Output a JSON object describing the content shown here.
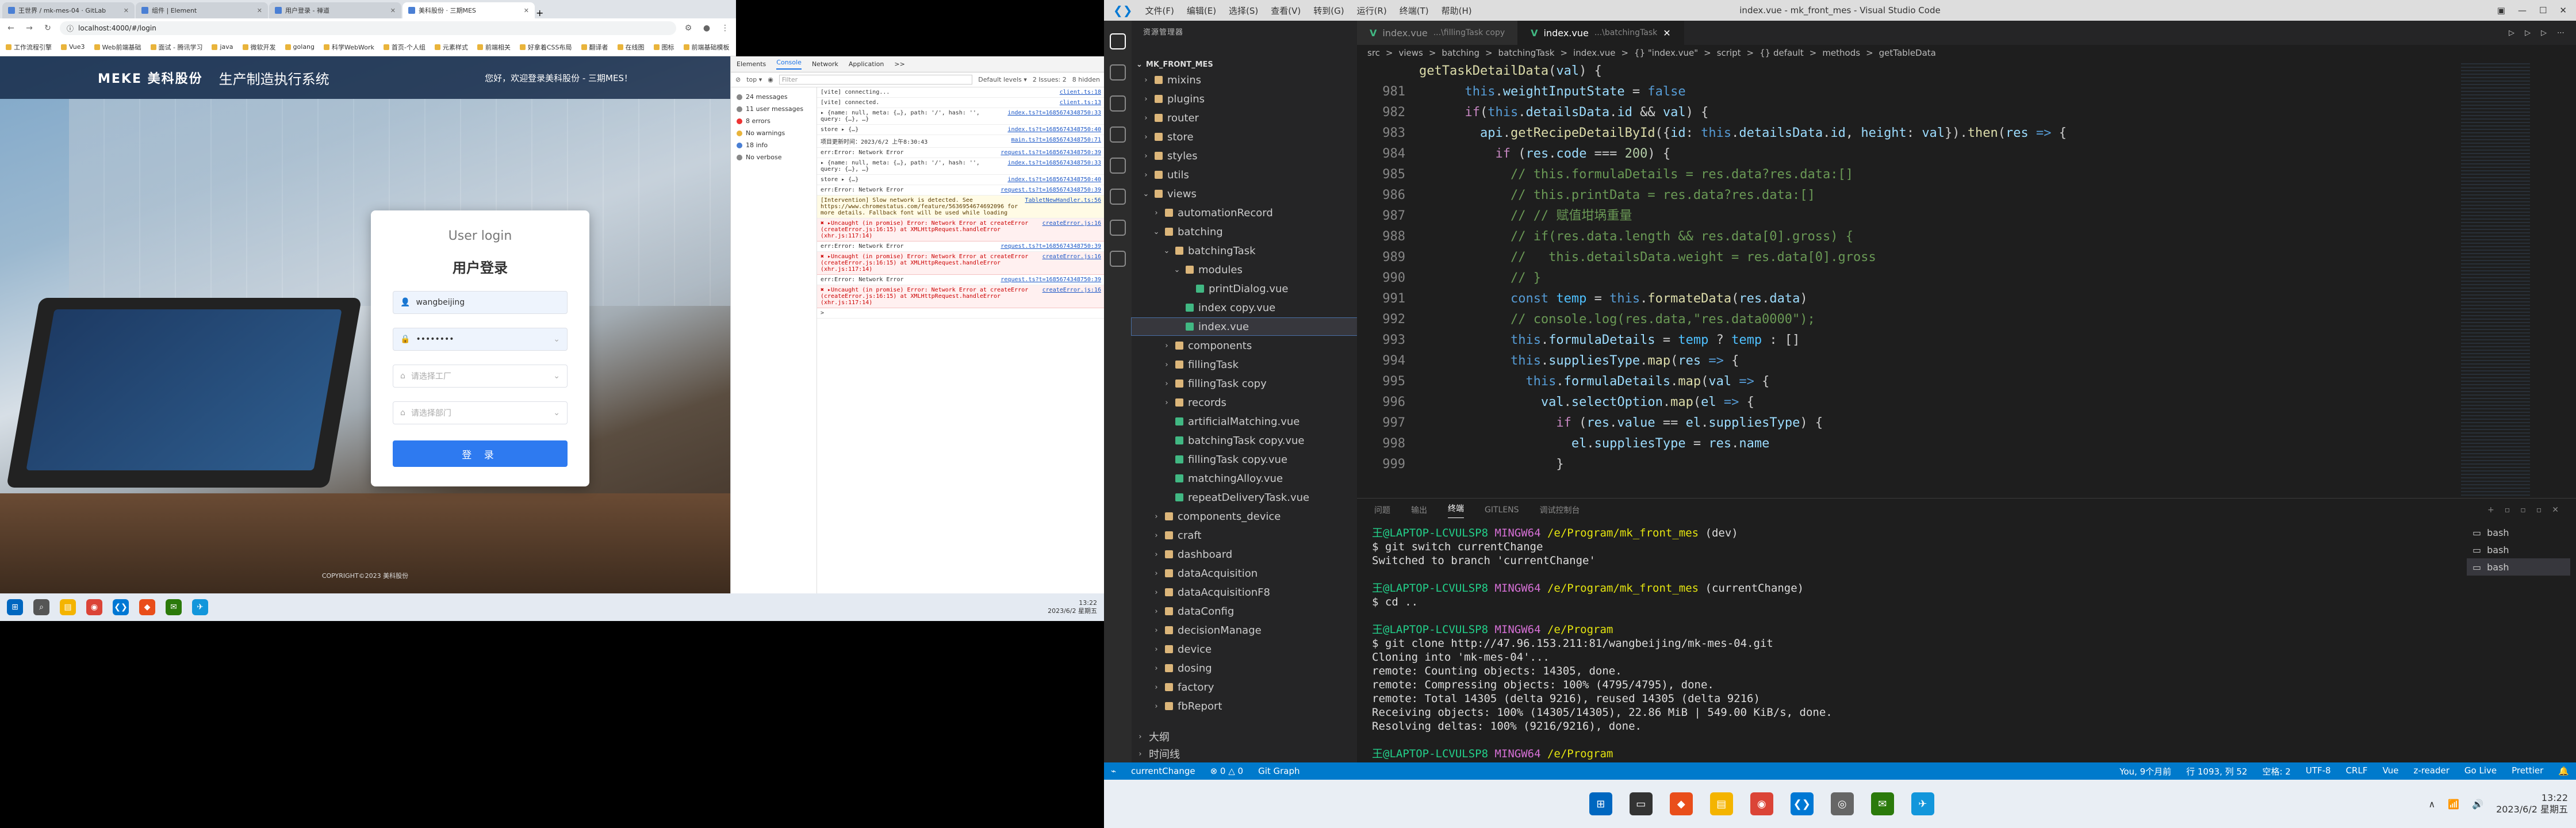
{
  "browser": {
    "tabs": [
      {
        "label": "王世界 / mk-mes-04 · GitLab",
        "active": false
      },
      {
        "label": "组件 | Element",
        "active": false
      },
      {
        "label": "用户登录 - 禅道",
        "active": false
      },
      {
        "label": "美科股份 · 三期MES",
        "active": true
      }
    ],
    "url": "localhost:4000/#/login",
    "bookmarks": [
      "工作流程引擎",
      "Vue3",
      "Web前端基础",
      "面试 - 腾讯学习",
      "java",
      "微软开发",
      "golang",
      "科学WebWork",
      "首页-个人组",
      "元素样式",
      "前端相关",
      "好拿着CSS布局",
      "翻译者",
      "在线图",
      "图标",
      "前端基础模板",
      "更多书签"
    ]
  },
  "page": {
    "logo": "MEKE 美科股份",
    "system_title": "生产制造执行系统",
    "welcome": "您好，欢迎登录美科股份 - 三期MES！",
    "login_en": "User login",
    "login_cn": "用户登录",
    "username": "wangbeijing",
    "password": "••••••••",
    "field3_placeholder": "请选择工厂",
    "field4_placeholder": "请选择部门",
    "login_btn": "登 录",
    "copyright": "COPYRIGHT©2023 美科股份"
  },
  "devtools": {
    "tabs": [
      "Elements",
      "Console",
      "Network",
      "Application",
      ">>"
    ],
    "active_tab": "Console",
    "filter": "Filter",
    "level": "Default levels ▾",
    "issues": "2 Issues: 2",
    "hidden": "8 hidden",
    "side": [
      {
        "label": "24 messages",
        "kind": "all"
      },
      {
        "label": "11 user messages",
        "kind": "all"
      },
      {
        "label": "8 errors",
        "kind": "err"
      },
      {
        "label": "No warnings",
        "kind": "warn"
      },
      {
        "label": "18 info",
        "kind": "info"
      },
      {
        "label": "No verbose",
        "kind": "all"
      }
    ],
    "logs": [
      {
        "t": "[vite] connecting...",
        "s": "client.ts:18",
        "k": ""
      },
      {
        "t": "[vite] connected.",
        "s": "client.ts:13",
        "k": ""
      },
      {
        "t": "▸ {name: null, meta: {…}, path: '/', hash: '', query: {…}, …}",
        "s": "index.ts?t=1685674348750:33",
        "k": ""
      },
      {
        "t": "store ▸ {…}",
        "s": "index.ts?t=1685674348750:40",
        "k": ""
      },
      {
        "t": "项目更新时间：2023/6/2 上午8:30:43",
        "s": "main.ts?t=1685674348750:71",
        "k": ""
      },
      {
        "t": "err:Error: Network Error",
        "s": "request.ts?t=1685674348750:39",
        "k": ""
      },
      {
        "t": "▸ {name: null, meta: {…}, path: '/', hash: '', query: {…}, …}",
        "s": "index.ts?t=1685674348750:33",
        "k": ""
      },
      {
        "t": "store ▸ {…}",
        "s": "index.ts?t=1685674348750:40",
        "k": ""
      },
      {
        "t": "err:Error: Network Error",
        "s": "request.ts?t=1685674348750:39",
        "k": ""
      },
      {
        "t": "[Intervention] Slow network is detected. See https://www.chromestatus.com/feature/5636954674692096 for more details. Fallback font will be used while loading",
        "s": "TabletNewHandler.ts:56",
        "k": "warn"
      },
      {
        "t": "✖ ▸Uncaught (in promise) Error: Network Error at createError (createError.js:16:15) at XMLHttpRequest.handleError (xhr.js:117:14)",
        "s": "createError.js:16",
        "k": "err"
      },
      {
        "t": "err:Error: Network Error",
        "s": "request.ts?t=1685674348750:39",
        "k": ""
      },
      {
        "t": "✖ ▸Uncaught (in promise) Error: Network Error at createError (createError.js:16:15) at XMLHttpRequest.handleError (xhr.js:117:14)",
        "s": "createError.js:16",
        "k": "err"
      },
      {
        "t": "err:Error: Network Error",
        "s": "request.ts?t=1685674348750:39",
        "k": ""
      },
      {
        "t": "✖ ▸Uncaught (in promise) Error: Network Error at createError (createError.js:16:15) at XMLHttpRequest.handleError (xhr.js:117:14)",
        "s": "createError.js:16",
        "k": "err"
      },
      {
        "t": ">",
        "s": "",
        "k": ""
      }
    ]
  },
  "taskbar1": {
    "time": "13:22",
    "date": "2023/6/2 星期五"
  },
  "vscode": {
    "menu": [
      "文件(F)",
      "编辑(E)",
      "选择(S)",
      "查看(V)",
      "转到(G)",
      "运行(R)",
      "终端(T)",
      "帮助(H)"
    ],
    "title": "index.vue - mk_front_mes - Visual Studio Code",
    "explorer_title": "资源管理器",
    "root": "MK_FRONT_MES",
    "tree": [
      {
        "n": "mixins",
        "d": 1,
        "t": "folder"
      },
      {
        "n": "plugins",
        "d": 1,
        "t": "folder"
      },
      {
        "n": "router",
        "d": 1,
        "t": "folder"
      },
      {
        "n": "store",
        "d": 1,
        "t": "folder"
      },
      {
        "n": "styles",
        "d": 1,
        "t": "folder"
      },
      {
        "n": "utils",
        "d": 1,
        "t": "folder"
      },
      {
        "n": "views",
        "d": 1,
        "t": "open"
      },
      {
        "n": "automationRecord",
        "d": 2,
        "t": "folder"
      },
      {
        "n": "batching",
        "d": 2,
        "t": "open"
      },
      {
        "n": "batchingTask",
        "d": 3,
        "t": "open"
      },
      {
        "n": "modules",
        "d": 4,
        "t": "open"
      },
      {
        "n": "printDialog.vue",
        "d": 5,
        "t": "vue"
      },
      {
        "n": "index copy.vue",
        "d": 4,
        "t": "vue"
      },
      {
        "n": "index.vue",
        "d": 4,
        "t": "vue",
        "sel": true
      },
      {
        "n": "components",
        "d": 3,
        "t": "folder"
      },
      {
        "n": "fillingTask",
        "d": 3,
        "t": "folder"
      },
      {
        "n": "fillingTask copy",
        "d": 3,
        "t": "folder"
      },
      {
        "n": "records",
        "d": 3,
        "t": "folder"
      },
      {
        "n": "artificialMatching.vue",
        "d": 3,
        "t": "vue"
      },
      {
        "n": "batchingTask copy.vue",
        "d": 3,
        "t": "vue"
      },
      {
        "n": "fillingTask copy.vue",
        "d": 3,
        "t": "vue"
      },
      {
        "n": "matchingAlloy.vue",
        "d": 3,
        "t": "vue"
      },
      {
        "n": "repeatDeliveryTask.vue",
        "d": 3,
        "t": "vue"
      },
      {
        "n": "components_device",
        "d": 2,
        "t": "folder"
      },
      {
        "n": "craft",
        "d": 2,
        "t": "folder"
      },
      {
        "n": "dashboard",
        "d": 2,
        "t": "folder"
      },
      {
        "n": "dataAcquisition",
        "d": 2,
        "t": "folder"
      },
      {
        "n": "dataAcquisitionF8",
        "d": 2,
        "t": "folder"
      },
      {
        "n": "dataConfig",
        "d": 2,
        "t": "folder"
      },
      {
        "n": "decisionManage",
        "d": 2,
        "t": "folder"
      },
      {
        "n": "device",
        "d": 2,
        "t": "folder"
      },
      {
        "n": "dosing",
        "d": 2,
        "t": "folder"
      },
      {
        "n": "factory",
        "d": 2,
        "t": "folder"
      },
      {
        "n": "fbReport",
        "d": 2,
        "t": "folder"
      }
    ],
    "outline": "大纲",
    "timeline": "时间线",
    "tabs": [
      {
        "label": "index.vue",
        "desc": "...\\fillingTask copy",
        "on": false
      },
      {
        "label": "index.vue",
        "desc": "...\\batchingTask",
        "on": true
      }
    ],
    "breadcrumb": [
      "src",
      ">",
      "views",
      ">",
      "batching",
      ">",
      "batchingTask",
      ">",
      "index.vue",
      ">",
      "{} \"index.vue\"",
      ">",
      "script",
      ">",
      "{} default",
      ">",
      "methods",
      ">",
      "getTableData"
    ],
    "code": [
      {
        "n": "",
        "h": "<span style='color:#dcdcaa'>getTaskDetailData</span>(<span style='color:#9cdcfe'>val</span>) {"
      },
      {
        "n": "981",
        "h": "      <span style='color:#569cd6'>this</span>.<span style='color:#9cdcfe'>weightInputState</span> = <span style='color:#569cd6'>false</span>"
      },
      {
        "n": "982",
        "h": "      <span style='color:#c586c0'>if</span>(<span style='color:#569cd6'>this</span>.<span style='color:#9cdcfe'>detailsData</span>.<span style='color:#9cdcfe'>id</span> &amp;&amp; <span style='color:#9cdcfe'>val</span>) {"
      },
      {
        "n": "983",
        "h": "        <span style='color:#9cdcfe'>api</span>.<span style='color:#dcdcaa'>getRecipeDetailById</span>({<span style='color:#9cdcfe'>id</span>: <span style='color:#569cd6'>this</span>.<span style='color:#9cdcfe'>detailsData</span>.<span style='color:#9cdcfe'>id</span>, <span style='color:#9cdcfe'>height</span>: <span style='color:#9cdcfe'>val</span>}).<span style='color:#dcdcaa'>then</span>(<span style='color:#9cdcfe'>res</span> <span style='color:#569cd6'>=&gt;</span> {"
      },
      {
        "n": "984",
        "h": "          <span style='color:#c586c0'>if</span> (<span style='color:#9cdcfe'>res</span>.<span style='color:#9cdcfe'>code</span> === <span style='color:#b5cea8'>200</span>) {"
      },
      {
        "n": "985",
        "h": "            <span style='color:#6a9955'>// this.formulaDetails = res.data?res.data:[]</span>"
      },
      {
        "n": "986",
        "h": "            <span style='color:#6a9955'>// this.printData = res.data?res.data:[]</span>"
      },
      {
        "n": "987",
        "h": "            <span style='color:#6a9955'>// // 赋值坩埚重量</span>"
      },
      {
        "n": "988",
        "h": "            <span style='color:#6a9955'>// if(res.data.length &amp;&amp; res.data[0].gross) {</span>"
      },
      {
        "n": "989",
        "h": "            <span style='color:#6a9955'>//   this.detailsData.weight = res.data[0].gross</span>"
      },
      {
        "n": "990",
        "h": "            <span style='color:#6a9955'>// }</span>"
      },
      {
        "n": "991",
        "h": "            <span style='color:#569cd6'>const</span> <span style='color:#4fc1ff'>temp</span> = <span style='color:#569cd6'>this</span>.<span style='color:#dcdcaa'>formateData</span>(<span style='color:#9cdcfe'>res</span>.<span style='color:#9cdcfe'>data</span>)"
      },
      {
        "n": "992",
        "h": "            <span style='color:#6a9955'>// console.log(res.data,\"res.data0000\");</span>"
      },
      {
        "n": "993",
        "h": "            <span style='color:#569cd6'>this</span>.<span style='color:#9cdcfe'>formulaDetails</span> = <span style='color:#4fc1ff'>temp</span> ? <span style='color:#4fc1ff'>temp</span> : []"
      },
      {
        "n": "994",
        "h": "            <span style='color:#569cd6'>this</span>.<span style='color:#9cdcfe'>suppliesType</span>.<span style='color:#dcdcaa'>map</span>(<span style='color:#9cdcfe'>res</span> <span style='color:#569cd6'>=&gt;</span> {"
      },
      {
        "n": "995",
        "h": "              <span style='color:#569cd6'>this</span>.<span style='color:#9cdcfe'>formulaDetails</span>.<span style='color:#dcdcaa'>map</span>(<span style='color:#9cdcfe'>val</span> <span style='color:#569cd6'>=&gt;</span> {"
      },
      {
        "n": "996",
        "h": "                <span style='color:#9cdcfe'>val</span>.<span style='color:#9cdcfe'>selectOption</span>.<span style='color:#dcdcaa'>map</span>(<span style='color:#9cdcfe'>el</span> <span style='color:#569cd6'>=&gt;</span> {"
      },
      {
        "n": "997",
        "h": "                  <span style='color:#c586c0'>if</span> (<span style='color:#9cdcfe'>res</span>.<span style='color:#9cdcfe'>value</span> == <span style='color:#9cdcfe'>el</span>.<span style='color:#9cdcfe'>suppliesType</span>) {"
      },
      {
        "n": "998",
        "h": "                    <span style='color:#9cdcfe'>el</span>.<span style='color:#9cdcfe'>suppliesType</span> = <span style='color:#9cdcfe'>res</span>.<span style='color:#9cdcfe'>name</span>"
      },
      {
        "n": "999",
        "h": "                  }"
      }
    ],
    "panel_tabs": [
      "问题",
      "输出",
      "终端",
      "GITLENS",
      "调试控制台"
    ],
    "active_panel": "终端",
    "terminal": [
      {
        "t": [
          {
            "c": "g",
            "v": "王@LAPTOP-LCVULSP8 "
          },
          {
            "c": "m",
            "v": "MINGW64 "
          },
          {
            "c": "y",
            "v": "/e/Program/mk_front_mes "
          },
          {
            "c": "",
            "v": "(dev)"
          }
        ]
      },
      {
        "t": [
          {
            "c": "",
            "v": "$ git switch currentChange"
          }
        ]
      },
      {
        "t": [
          {
            "c": "",
            "v": "Switched to branch 'currentChange'"
          }
        ]
      },
      {
        "t": [
          {
            "c": "",
            "v": ""
          }
        ]
      },
      {
        "t": [
          {
            "c": "g",
            "v": "王@LAPTOP-LCVULSP8 "
          },
          {
            "c": "m",
            "v": "MINGW64 "
          },
          {
            "c": "y",
            "v": "/e/Program/mk_front_mes "
          },
          {
            "c": "",
            "v": "(currentChange)"
          }
        ]
      },
      {
        "t": [
          {
            "c": "",
            "v": "$ cd .."
          }
        ]
      },
      {
        "t": [
          {
            "c": "",
            "v": ""
          }
        ]
      },
      {
        "t": [
          {
            "c": "g",
            "v": "王@LAPTOP-LCVULSP8 "
          },
          {
            "c": "m",
            "v": "MINGW64 "
          },
          {
            "c": "y",
            "v": "/e/Program"
          }
        ]
      },
      {
        "t": [
          {
            "c": "",
            "v": "$ git clone http://47.96.153.211:81/wangbeijing/mk-mes-04.git"
          }
        ]
      },
      {
        "t": [
          {
            "c": "",
            "v": "Cloning into 'mk-mes-04'..."
          }
        ]
      },
      {
        "t": [
          {
            "c": "",
            "v": "remote: Counting objects: 14305, done."
          }
        ]
      },
      {
        "t": [
          {
            "c": "",
            "v": "remote: Compressing objects: 100% (4795/4795), done."
          }
        ]
      },
      {
        "t": [
          {
            "c": "",
            "v": "remote: Total 14305 (delta 9216), reused 14305 (delta 9216)"
          }
        ]
      },
      {
        "t": [
          {
            "c": "",
            "v": "Receiving objects: 100% (14305/14305), 22.86 MiB | 549.00 KiB/s, done."
          }
        ]
      },
      {
        "t": [
          {
            "c": "",
            "v": "Resolving deltas: 100% (9216/9216), done."
          }
        ]
      },
      {
        "t": [
          {
            "c": "",
            "v": ""
          }
        ]
      },
      {
        "t": [
          {
            "c": "g",
            "v": "王@LAPTOP-LCVULSP8 "
          },
          {
            "c": "m",
            "v": "MINGW64 "
          },
          {
            "c": "y",
            "v": "/e/Program"
          }
        ]
      },
      {
        "t": [
          {
            "c": "",
            "v": "$ ▯"
          }
        ]
      }
    ],
    "terminals": [
      "bash",
      "bash",
      "bash"
    ],
    "status_left": [
      "currentChange",
      "⊗ 0 △ 0",
      "Git Graph"
    ],
    "status_right": [
      "Lines: You, 9个月前",
      "行 1093，列 52",
      "空格: 2",
      "UTF-8",
      "CRLF",
      "Vue",
      "z-reader",
      "Go Live",
      "Prettier"
    ],
    "status_right_display": [
      "You, 9个月前",
      "行 1093, 列 52",
      "空格: 2",
      "UTF-8",
      "CRLF",
      "Vue",
      "z-reader",
      "Go Live",
      "Prettier"
    ]
  },
  "taskbar2": {
    "time": "13:22",
    "date": "2023/6/2 星期五"
  },
  "colors": {
    "accent": "#007acc",
    "login_btn": "#2e7af0",
    "error": "#e33"
  }
}
